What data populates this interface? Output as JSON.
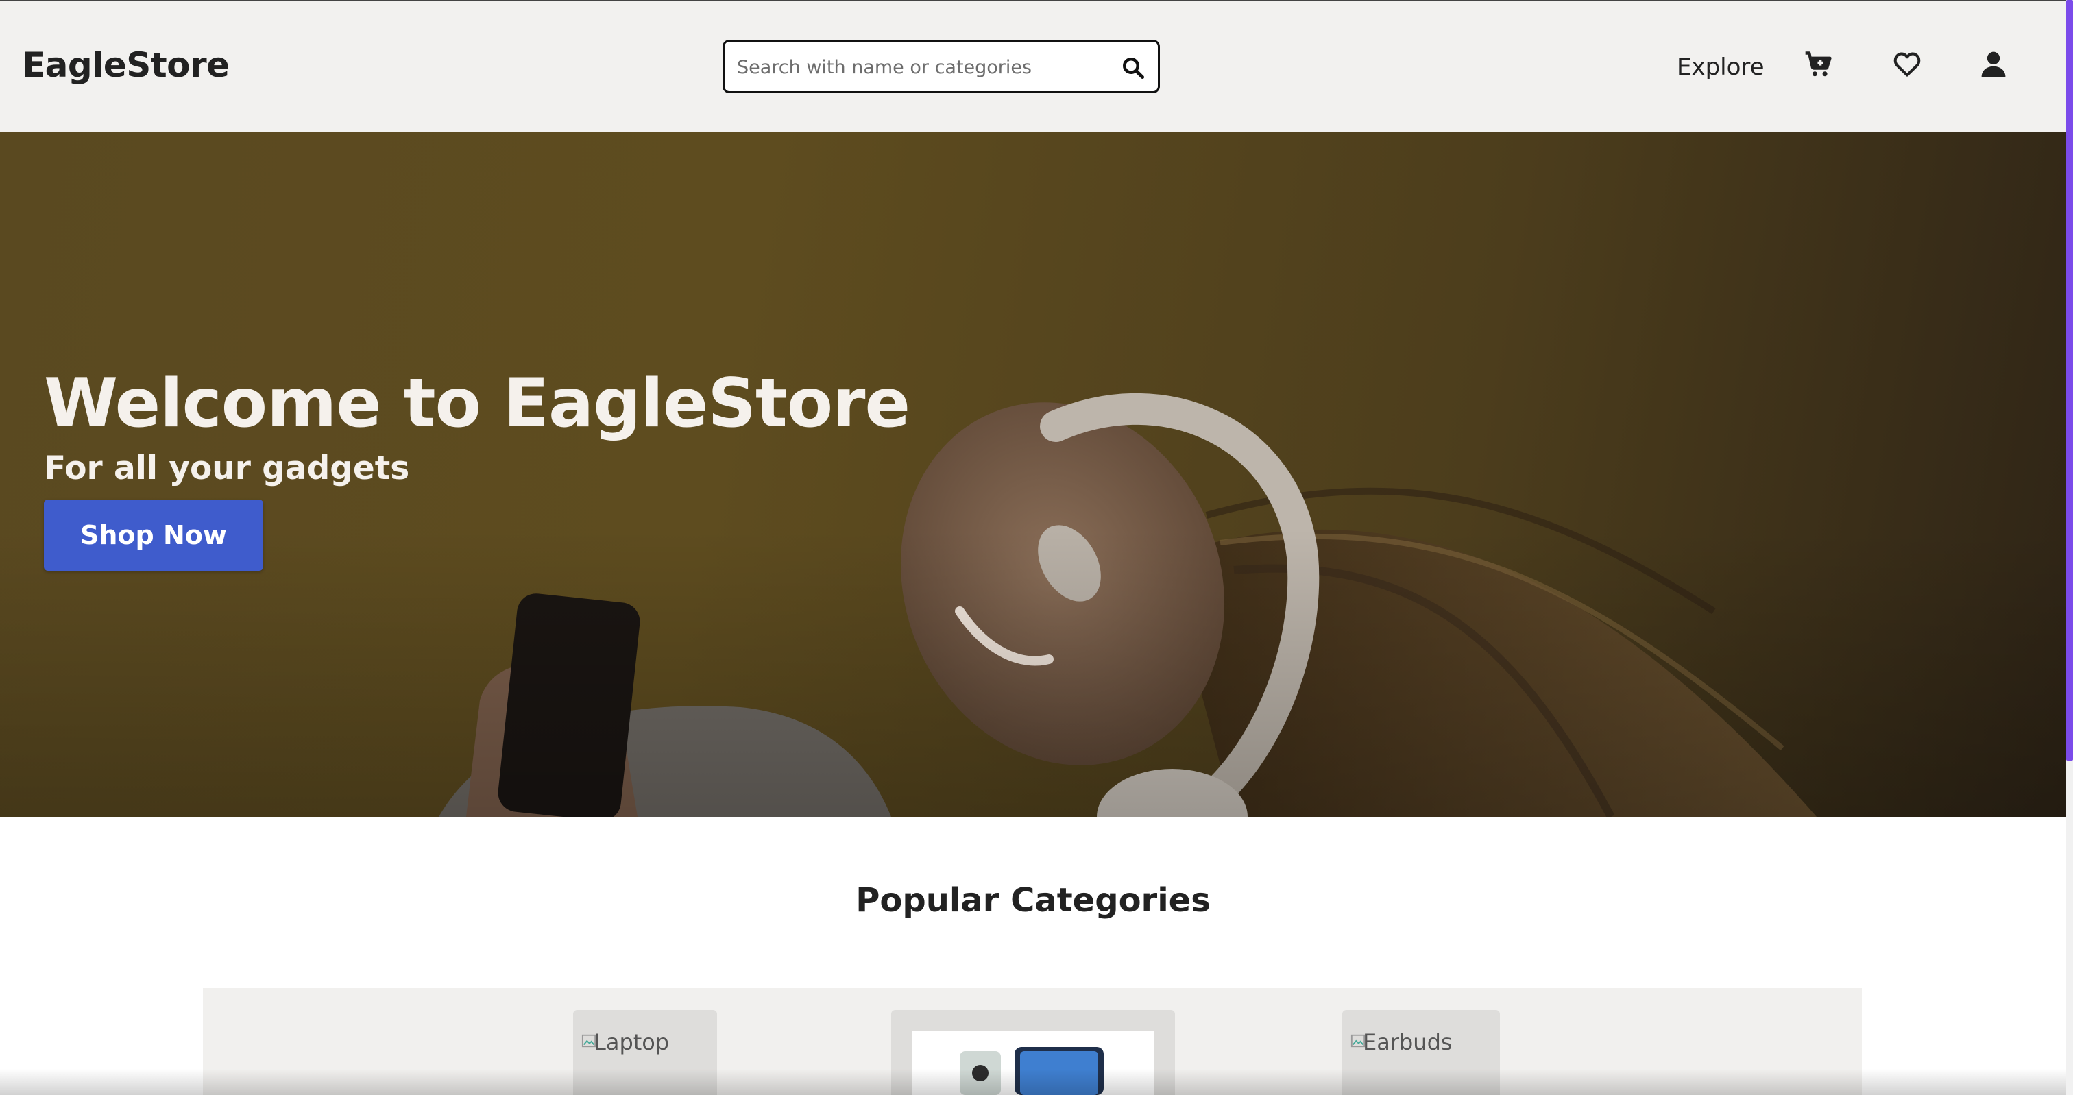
{
  "header": {
    "logo": "EagleStore",
    "search": {
      "placeholder": "Search with name or categories",
      "value": ""
    },
    "nav": {
      "explore_label": "Explore",
      "icons": [
        "cart-icon",
        "heart-icon",
        "user-icon"
      ]
    }
  },
  "hero": {
    "title": "Welcome to EagleStore",
    "subtitle": "For all your gadgets",
    "cta_label": "Shop Now"
  },
  "categories": {
    "title": "Popular Categories",
    "items": [
      {
        "alt": "Laptop"
      },
      {
        "alt": ""
      },
      {
        "alt": "Earbuds"
      }
    ]
  },
  "colors": {
    "header_bg": "#f2f1ef",
    "hero_overlay": "#5a4920",
    "cta_bg": "#3f5ccc",
    "scrollbar_thumb": "#7b4bea"
  }
}
